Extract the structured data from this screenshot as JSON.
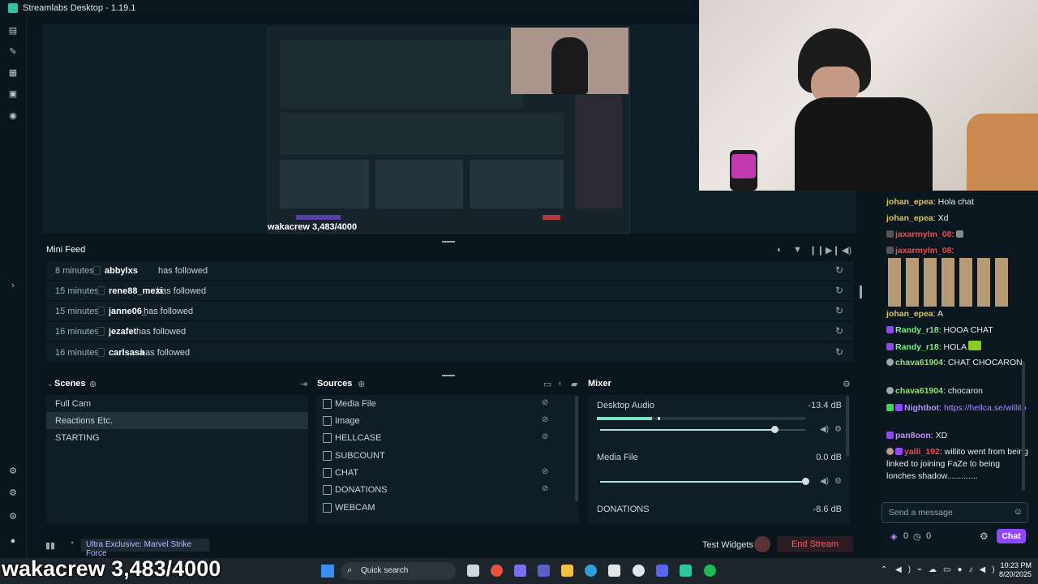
{
  "app": {
    "title": "Streamlabs Desktop - 1.19.1"
  },
  "preview": {
    "label": "wakacrew 3,483/4000"
  },
  "minifeed": {
    "title": "Mini Feed",
    "rows": [
      {
        "time": "8 minutes",
        "user": "abbylxs",
        "action": "has followed"
      },
      {
        "time": "15 minutes",
        "user": "rene88_mexi",
        "action": "has followed"
      },
      {
        "time": "15 minutes",
        "user": "janne06_",
        "action": "has followed"
      },
      {
        "time": "16 minutes",
        "user": "jezafet",
        "action": "has followed"
      },
      {
        "time": "16 minutes",
        "user": "carlsasa",
        "action": "has followed"
      }
    ]
  },
  "scenes": {
    "title": "Scenes",
    "items": [
      "Full Cam",
      "Reactions Etc.",
      "STARTING"
    ]
  },
  "sources": {
    "title": "Sources",
    "items": [
      "Media File",
      "Image",
      "HELLCASE",
      "SUBCOUNT",
      "CHAT",
      "DONATIONS",
      "WEBCAM"
    ]
  },
  "mixer": {
    "title": "Mixer",
    "channels": [
      {
        "name": "Desktop Audio",
        "db": "-13.4 dB",
        "level": 0.85
      },
      {
        "name": "Media File",
        "db": "0.0 dB",
        "level": 1.0
      },
      {
        "name": "DONATIONS",
        "db": "-8.6 dB",
        "level": 0.0
      }
    ]
  },
  "footer": {
    "banner": "Ultra Exclusive: Marvel Strike Force",
    "test_widgets": "Test Widgets",
    "end_stream": "End Stream"
  },
  "chat": {
    "messages": [
      {
        "user": "johan_epea",
        "text": "Hola chat",
        "color": "#e8c24a"
      },
      {
        "user": "johan_epea",
        "text": "Xd",
        "color": "#e8c24a"
      },
      {
        "user": "jaxarmylm_08",
        "text": "",
        "color": "#ff4545"
      },
      {
        "user": "jaxarmylm_08",
        "text": "",
        "color": "#ff4545"
      },
      {
        "user": "johan_epea",
        "text": "A",
        "color": "#e8c24a"
      },
      {
        "user": "Randy_r18",
        "text": "HOOA CHAT",
        "color": "#7cf089"
      },
      {
        "user": "Randy_r18",
        "text": "HOLA",
        "color": "#7cf089"
      },
      {
        "user": "chava61904",
        "text": "CHAT CHOCARON",
        "color": "#8fe07a"
      },
      {
        "user": "chava61904",
        "text": "chocaron",
        "color": "#8fe07a"
      },
      {
        "user": "Nightbot",
        "text": "https://hellca.se/willito",
        "color": "#b591ff"
      },
      {
        "user": "pan8oon",
        "text": "XD",
        "color": "#c88cff"
      },
      {
        "user": "yalli_192",
        "text": "willito went from being linked to joining FaZe to being lonches shadow.............",
        "color": "#ff4545"
      }
    ],
    "input_placeholder": "Send a message",
    "points_a": "0",
    "points_b": "0",
    "chat_button": "Chat"
  },
  "overlay": {
    "text": "wakacrew 3,483/4000"
  },
  "taskbar": {
    "search": "Quick search",
    "time": "10:23 PM",
    "date": "8/20/2025"
  }
}
